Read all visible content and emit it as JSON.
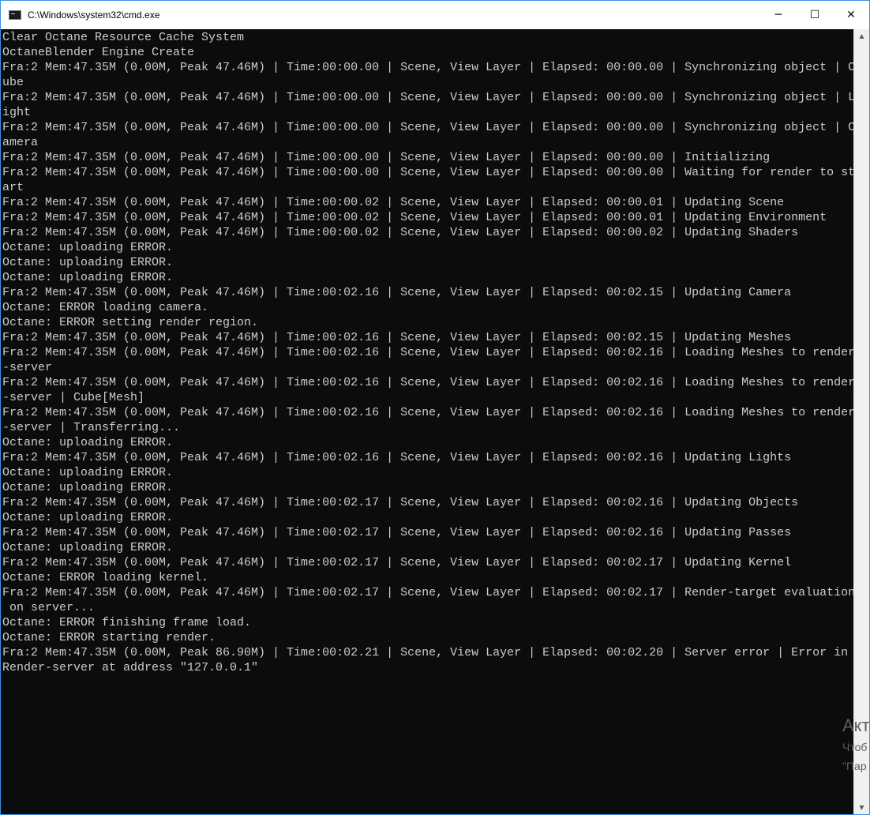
{
  "window": {
    "title": "C:\\Windows\\system32\\cmd.exe",
    "controls": {
      "minimize": "─",
      "maximize": "☐",
      "close": "✕"
    }
  },
  "console": {
    "lines": [
      "Clear Octane Resource Cache System",
      "OctaneBlender Engine Create",
      "Fra:2 Mem:47.35M (0.00M, Peak 47.46M) | Time:00:00.00 | Scene, View Layer | Elapsed: 00:00.00 | Synchronizing object | C",
      "ube",
      "Fra:2 Mem:47.35M (0.00M, Peak 47.46M) | Time:00:00.00 | Scene, View Layer | Elapsed: 00:00.00 | Synchronizing object | L",
      "ight",
      "Fra:2 Mem:47.35M (0.00M, Peak 47.46M) | Time:00:00.00 | Scene, View Layer | Elapsed: 00:00.00 | Synchronizing object | C",
      "amera",
      "Fra:2 Mem:47.35M (0.00M, Peak 47.46M) | Time:00:00.00 | Scene, View Layer | Elapsed: 00:00.00 | Initializing",
      "Fra:2 Mem:47.35M (0.00M, Peak 47.46M) | Time:00:00.00 | Scene, View Layer | Elapsed: 00:00.00 | Waiting for render to st",
      "art",
      "Fra:2 Mem:47.35M (0.00M, Peak 47.46M) | Time:00:00.02 | Scene, View Layer | Elapsed: 00:00.01 | Updating Scene",
      "Fra:2 Mem:47.35M (0.00M, Peak 47.46M) | Time:00:00.02 | Scene, View Layer | Elapsed: 00:00.01 | Updating Environment",
      "Fra:2 Mem:47.35M (0.00M, Peak 47.46M) | Time:00:00.02 | Scene, View Layer | Elapsed: 00:00.02 | Updating Shaders",
      "Octane: uploading ERROR.",
      "Octane: uploading ERROR.",
      "Octane: uploading ERROR.",
      "Fra:2 Mem:47.35M (0.00M, Peak 47.46M) | Time:00:02.16 | Scene, View Layer | Elapsed: 00:02.15 | Updating Camera",
      "Octane: ERROR loading camera.",
      "Octane: ERROR setting render region.",
      "Fra:2 Mem:47.35M (0.00M, Peak 47.46M) | Time:00:02.16 | Scene, View Layer | Elapsed: 00:02.15 | Updating Meshes",
      "Fra:2 Mem:47.35M (0.00M, Peak 47.46M) | Time:00:02.16 | Scene, View Layer | Elapsed: 00:02.16 | Loading Meshes to render",
      "-server",
      "Fra:2 Mem:47.35M (0.00M, Peak 47.46M) | Time:00:02.16 | Scene, View Layer | Elapsed: 00:02.16 | Loading Meshes to render",
      "-server | Cube[Mesh]",
      "Fra:2 Mem:47.35M (0.00M, Peak 47.46M) | Time:00:02.16 | Scene, View Layer | Elapsed: 00:02.16 | Loading Meshes to render",
      "-server | Transferring...",
      "Octane: uploading ERROR.",
      "Fra:2 Mem:47.35M (0.00M, Peak 47.46M) | Time:00:02.16 | Scene, View Layer | Elapsed: 00:02.16 | Updating Lights",
      "Octane: uploading ERROR.",
      "Octane: uploading ERROR.",
      "Fra:2 Mem:47.35M (0.00M, Peak 47.46M) | Time:00:02.17 | Scene, View Layer | Elapsed: 00:02.16 | Updating Objects",
      "Octane: uploading ERROR.",
      "Fra:2 Mem:47.35M (0.00M, Peak 47.46M) | Time:00:02.17 | Scene, View Layer | Elapsed: 00:02.16 | Updating Passes",
      "Octane: uploading ERROR.",
      "Fra:2 Mem:47.35M (0.00M, Peak 47.46M) | Time:00:02.17 | Scene, View Layer | Elapsed: 00:02.17 | Updating Kernel",
      "Octane: ERROR loading kernel.",
      "Fra:2 Mem:47.35M (0.00M, Peak 47.46M) | Time:00:02.17 | Scene, View Layer | Elapsed: 00:02.17 | Render-target evaluation",
      " on server...",
      "Octane: ERROR finishing frame load.",
      "Octane: ERROR starting render.",
      "Fra:2 Mem:47.35M (0.00M, Peak 86.90M) | Time:00:02.21 | Scene, View Layer | Elapsed: 00:02.20 | Server error | Error in",
      "Render-server at address \"127.0.0.1\""
    ]
  },
  "scrollbar": {
    "up_arrow": "▲",
    "down_arrow": "▼"
  },
  "watermark": {
    "title": "Акт",
    "line1": "Чтоб",
    "line2": "\"Пар"
  },
  "colors": {
    "console_background": "#0c0c0c",
    "console_text": "#cccccc",
    "titlebar_background": "#ffffff",
    "window_border": "#3a8ee6"
  }
}
